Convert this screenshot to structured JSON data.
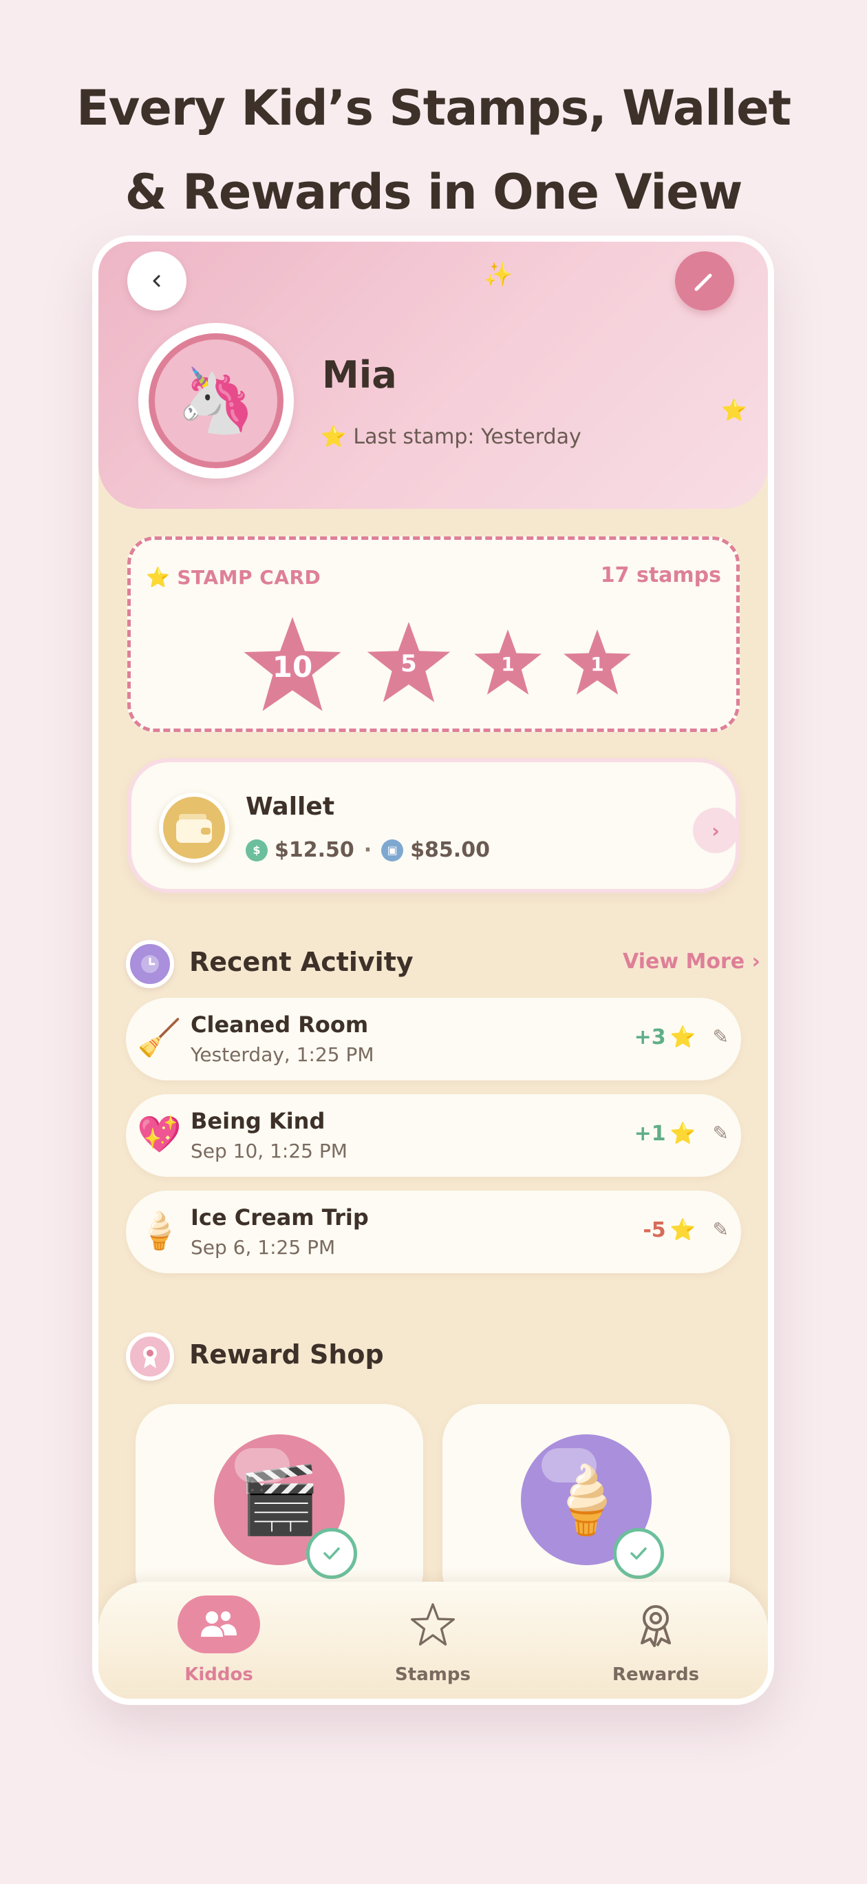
{
  "headline": {
    "line1": "Every Kid’s Stamps, Wallet",
    "line2": "& Rewards in One View"
  },
  "profile": {
    "name": "Mia",
    "avatar_emoji": "🦄",
    "last_stamp_star": "⭐",
    "last_stamp": "Last stamp: Yesterday"
  },
  "stamp_card": {
    "title": "STAMP CARD",
    "title_star": "⭐",
    "count_label": "17 stamps",
    "stamps": [
      {
        "value": "10"
      },
      {
        "value": "5"
      },
      {
        "value": "1"
      },
      {
        "value": "1"
      }
    ]
  },
  "wallet": {
    "title": "Wallet",
    "cash": "$12.50",
    "separator": "·",
    "savings": "$85.00",
    "chevron": "›"
  },
  "recent_activity": {
    "title": "Recent Activity",
    "view_more": "View More ›",
    "items": [
      {
        "emoji": "🧹",
        "title": "Cleaned Room",
        "time": "Yesterday, 1:25 PM",
        "points": "+3",
        "star": "⭐",
        "edit": "✎"
      },
      {
        "emoji": "💖",
        "title": "Being Kind",
        "time": "Sep 10, 1:25 PM",
        "points": "+1",
        "star": "⭐",
        "edit": "✎"
      },
      {
        "emoji": "🍦",
        "title": "Ice Cream Trip",
        "time": "Sep 6, 1:25 PM",
        "points": "-5",
        "star": "⭐",
        "edit": "✎"
      }
    ]
  },
  "reward_shop": {
    "title": "Reward Shop",
    "items": [
      {
        "emoji": "🎬",
        "color": "#e48aa2"
      },
      {
        "emoji": "🍦",
        "color": "#a98fdc"
      }
    ]
  },
  "tabs": [
    {
      "label": "Kiddos",
      "icon": "kids-icon",
      "active": true
    },
    {
      "label": "Stamps",
      "icon": "star-icon",
      "active": false
    },
    {
      "label": "Rewards",
      "icon": "ribbon-award-icon",
      "active": false
    }
  ],
  "colors": {
    "accent_pink": "#de7f98",
    "background": "#f8ecef",
    "card_cream": "#fdfbf3",
    "panel_beige": "#f6e8cf",
    "positive": "#5fae88",
    "negative": "#d86a5a"
  }
}
